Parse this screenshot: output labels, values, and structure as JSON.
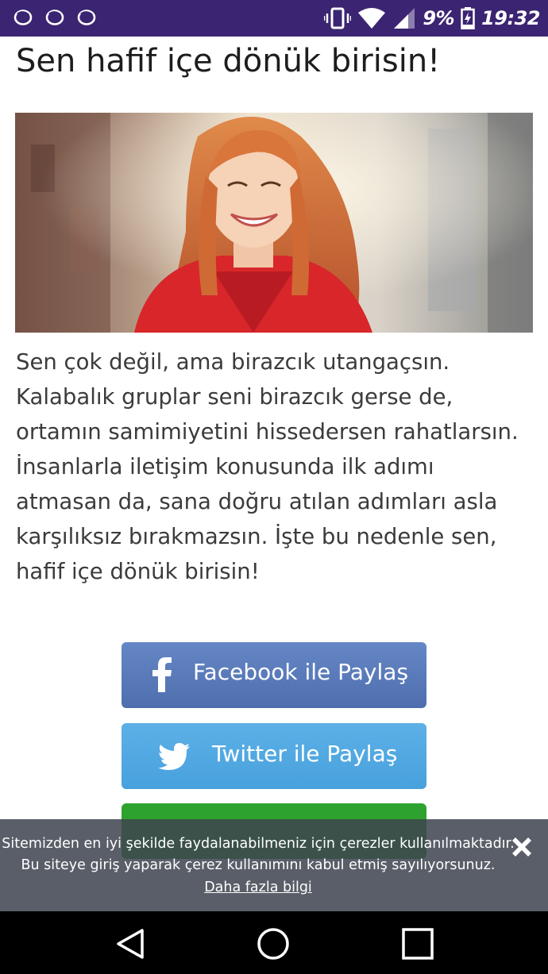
{
  "status_bar": {
    "battery": "9%",
    "time": "19:32",
    "icons": [
      "notification-ring-icon",
      "notification-ring-icon",
      "notification-ring-icon",
      "vibrate-icon",
      "wifi-icon",
      "signal-icon",
      "battery-icon"
    ]
  },
  "result": {
    "title": "Sen hafif içe dönük birisin!",
    "image_icon": "smiling-woman-photo",
    "description": "Sen çok değil, ama birazcık utangaçsın. Kalabalık gruplar seni birazcık gerse de, ortamın samimiyetini hissedersen rahatlarsın. İnsanlarla iletişim konusunda ilk adımı atmasan da, sana doğru atılan adımları asla karşılıksız bırakmazsın. İşte bu nedenle sen, hafif içe dönük birisin!"
  },
  "share": {
    "facebook_label": "Facebook ile Paylaş",
    "twitter_label": "Twitter ile Paylaş",
    "colors": {
      "facebook": "#5a7bbb",
      "twitter": "#53a9e2",
      "whatsapp": "#2ea22e"
    }
  },
  "cookie_banner": {
    "line1": "Sitemizden en iyi şekilde faydalanabilmeniz için çerezler kullanılmaktadır.",
    "line2": "Bu siteye giriş yaparak çerez kullanımını kabul etmiş sayılıyorsunuz.",
    "more_link": "Daha fazla bilgi"
  },
  "nav_bar": {
    "icons": [
      "back-icon",
      "home-icon",
      "recents-icon"
    ]
  }
}
